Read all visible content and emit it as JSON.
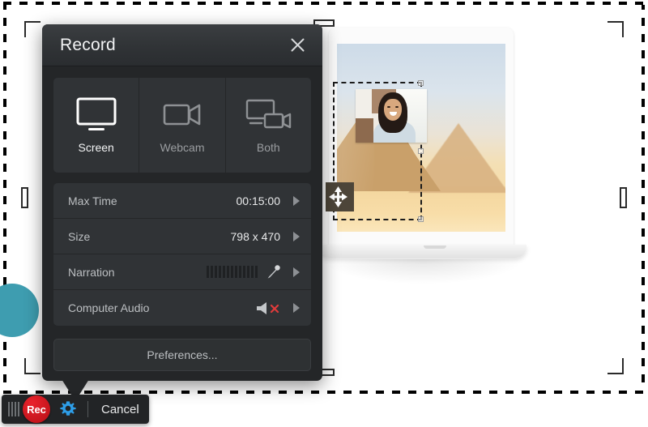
{
  "dialog": {
    "title": "Record",
    "close_icon": "close-icon",
    "modes": [
      {
        "label": "Screen",
        "icon": "monitor-icon",
        "active": true
      },
      {
        "label": "Webcam",
        "icon": "video-camera-icon",
        "active": false
      },
      {
        "label": "Both",
        "icon": "monitor-and-camera-icon",
        "active": false
      }
    ],
    "settings": [
      {
        "label": "Max Time",
        "value": "00:15:00",
        "widget": "none",
        "chevron": "chevron-right-icon"
      },
      {
        "label": "Size",
        "value": "798 x 470",
        "widget": "none",
        "chevron": "chevron-right-icon"
      },
      {
        "label": "Narration",
        "value": "",
        "widget": "audio-meter-microphone",
        "chevron": "chevron-right-icon"
      },
      {
        "label": "Computer Audio",
        "value": "",
        "widget": "speaker-muted",
        "chevron": "chevron-right-icon"
      }
    ],
    "preferences_label": "Preferences...",
    "audio_meter_bars": 13
  },
  "toolbar": {
    "grip_icon": "grip-handle-icon",
    "record_label": "Rec",
    "settings_icon": "gear-icon",
    "cancel_label": "Cancel"
  },
  "capture": {
    "region_label": "screen-capture-region",
    "move_cursor_icon": "move-cursor-icon"
  },
  "colors": {
    "dialog_bg": "#242628",
    "panel_bg": "#303336",
    "record_red": "#d01b23",
    "gear_blue": "#2e9ee8",
    "teal_accent": "#3e9db0",
    "mute_red": "#e03b3b"
  }
}
